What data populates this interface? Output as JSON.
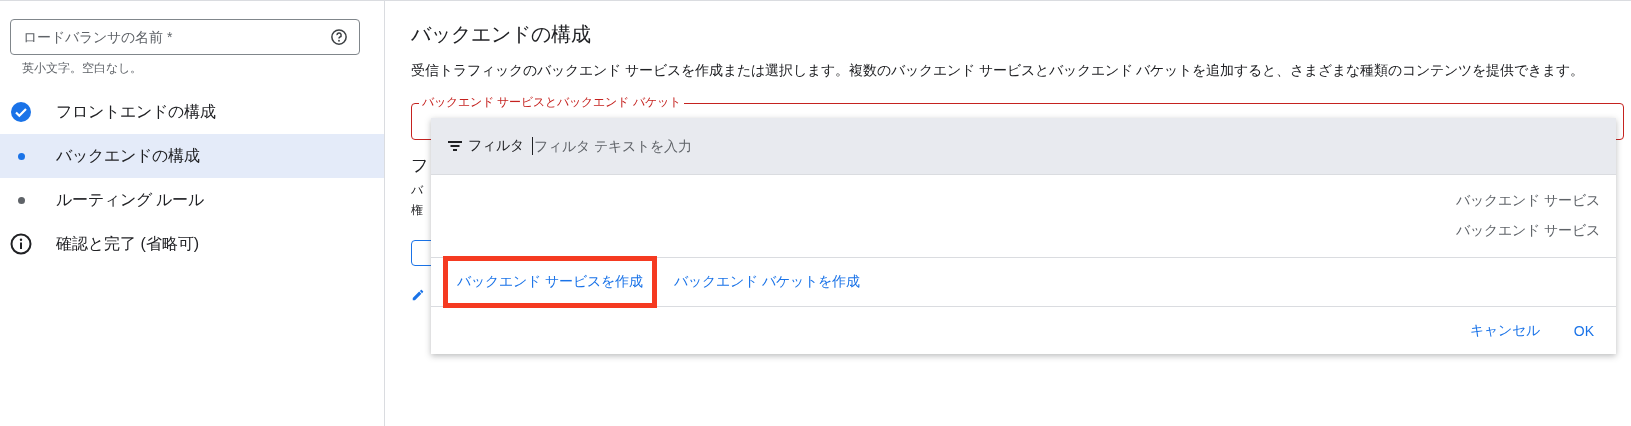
{
  "name_field": {
    "placeholder": "ロードバランサの名前 *",
    "hint": "英小文字。空白なし。"
  },
  "steps": [
    {
      "label": "フロントエンドの構成",
      "kind": "done",
      "selected": false
    },
    {
      "label": "バックエンドの構成",
      "kind": "current",
      "selected": true
    },
    {
      "label": "ルーティング ルール",
      "kind": "pending",
      "selected": false
    },
    {
      "label": "確認と完了 (省略可)",
      "kind": "info",
      "selected": false
    }
  ],
  "main": {
    "title": "バックエンドの構成",
    "description": "受信トラフィックのバックエンド サービスを作成または選択します。複数のバックエンド サービスとバックエンド バケットを追加すると、さまざまな種類のコンテンツを提供できます。",
    "field": {
      "label": "バックエンド サービスとバックエンド バケット",
      "error": true
    },
    "covered_heading": "フ",
    "covered_lines": [
      "バ",
      "権"
    ]
  },
  "dropdown": {
    "filter_label": "フィルタ",
    "filter_placeholder": "フィルタ テキストを入力",
    "options": [
      {
        "type": "バックエンド サービス"
      },
      {
        "type": "バックエンド サービス"
      }
    ],
    "create_links": [
      {
        "label": "バックエンド サービスを作成",
        "highlighted": true
      },
      {
        "label": "バックエンド バケットを作成",
        "highlighted": false
      }
    ],
    "buttons": [
      "キャンセル",
      "OK"
    ]
  }
}
